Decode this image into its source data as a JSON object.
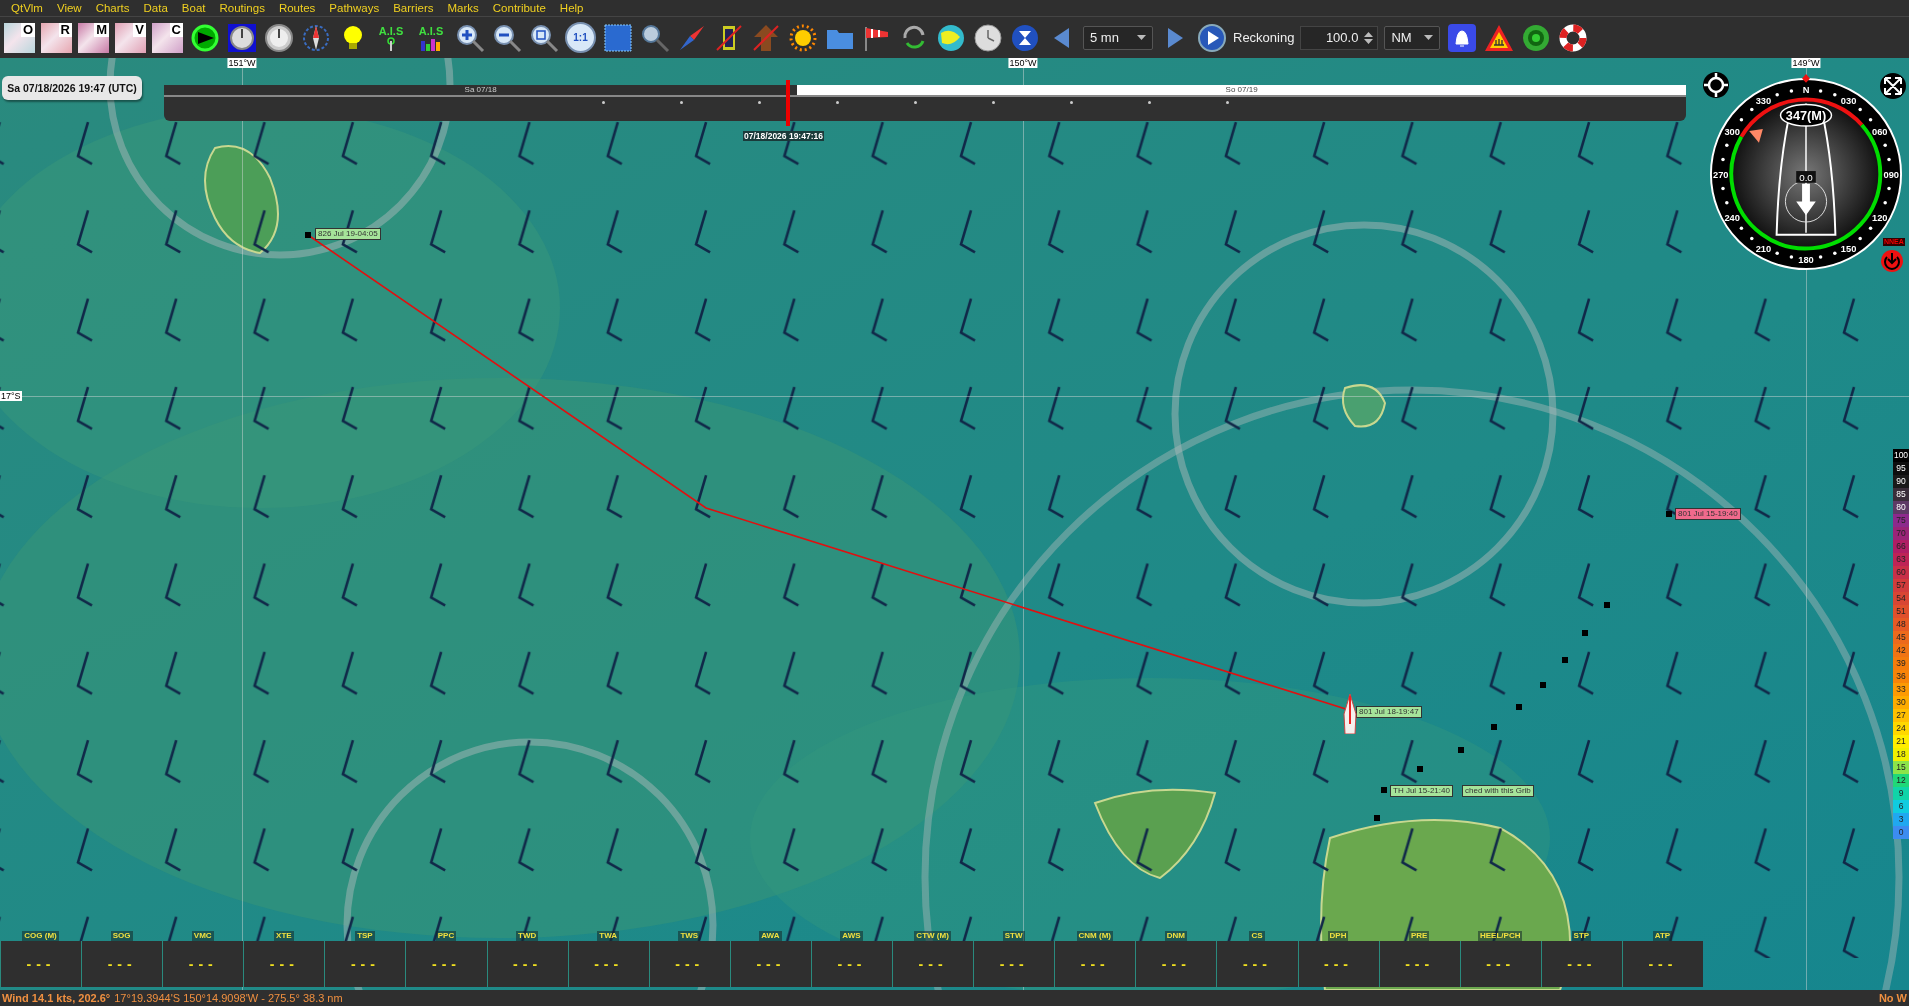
{
  "menu": [
    "QtVlm",
    "View",
    "Charts",
    "Data",
    "Boat",
    "Routings",
    "Routes",
    "Pathways",
    "Barriers",
    "Marks",
    "Contribute",
    "Help"
  ],
  "toolbar": {
    "chart_layers": [
      "O",
      "R",
      "M",
      "V",
      "C"
    ],
    "ais_labels": [
      "A.I.S",
      "A.I.S"
    ],
    "zoom_label": "1:1",
    "time_step": "5 mn",
    "mode_label": "Reckoning",
    "reckoning_value": "100.0",
    "unit": "NM"
  },
  "date_badge": "Sa 07/18/2026 19:47 (UTC)",
  "timeline": {
    "day_labels": [
      "Sa 07/18",
      "So 07/19"
    ],
    "cursor_label": "07/18/2026 19:47:16",
    "level": 0.41
  },
  "grid_labels": {
    "longitudes": [
      "151°W",
      "150°W",
      "149°W"
    ],
    "latitude": "17°S"
  },
  "marks": [
    {
      "label": "826 Jul 19-04:05",
      "color": "#a6e49a"
    },
    {
      "label": "801 Jul 18-19:47",
      "color": "#a6e49a"
    },
    {
      "label": "801 Jul 15-19:40",
      "color": "#f06a8c"
    },
    {
      "label": "TH Jul 15-21:40",
      "color": "#a6e49a"
    },
    {
      "label": "ched with this Grib",
      "color": "#a6e49a"
    }
  ],
  "compass": {
    "heading": "347(M)",
    "speed": "0.0",
    "ring_labels": [
      "N",
      "030",
      "060",
      "090",
      "120",
      "150",
      "180",
      "210",
      "240",
      "270",
      "300",
      "330"
    ],
    "nmea_label": "NNEA"
  },
  "wind_scale": [
    {
      "label": "100",
      "color": "#000000"
    },
    {
      "label": "95",
      "color": "#0e0e0e"
    },
    {
      "label": "90",
      "color": "#1a1a1a"
    },
    {
      "label": "85",
      "color": "#3a2e3a"
    },
    {
      "label": "80",
      "color": "#5e3a66"
    },
    {
      "label": "75",
      "color": "#8c2a8c"
    },
    {
      "label": "70",
      "color": "#9a2478"
    },
    {
      "label": "66",
      "color": "#b01e64"
    },
    {
      "label": "63",
      "color": "#be2456"
    },
    {
      "label": "60",
      "color": "#c83048"
    },
    {
      "label": "57",
      "color": "#d23c3c"
    },
    {
      "label": "54",
      "color": "#d84634"
    },
    {
      "label": "51",
      "color": "#e0502c"
    },
    {
      "label": "48",
      "color": "#e65a24"
    },
    {
      "label": "45",
      "color": "#ec6a1c"
    },
    {
      "label": "42",
      "color": "#f07414"
    },
    {
      "label": "39",
      "color": "#f47c0c"
    },
    {
      "label": "36",
      "color": "#f88408"
    },
    {
      "label": "33",
      "color": "#fc9a04"
    },
    {
      "label": "30",
      "color": "#feac00"
    },
    {
      "label": "27",
      "color": "#ffc000"
    },
    {
      "label": "24",
      "color": "#ffd800"
    },
    {
      "label": "21",
      "color": "#ffee00"
    },
    {
      "label": "18",
      "color": "#f0f000"
    },
    {
      "label": "15",
      "color": "#8ce44a"
    },
    {
      "label": "12",
      "color": "#20d878"
    },
    {
      "label": "9",
      "color": "#10d4a8"
    },
    {
      "label": "6",
      "color": "#10cce0"
    },
    {
      "label": "3",
      "color": "#20a8f0"
    },
    {
      "label": "0",
      "color": "#3c8cf0"
    }
  ],
  "instruments": [
    {
      "name": "COG (M)",
      "value": "---"
    },
    {
      "name": "SOG",
      "value": "---"
    },
    {
      "name": "VMC",
      "value": "---"
    },
    {
      "name": "XTE",
      "value": "---"
    },
    {
      "name": "TSP",
      "value": "---"
    },
    {
      "name": "PPC",
      "value": "---"
    },
    {
      "name": "TWD",
      "value": "---"
    },
    {
      "name": "TWA",
      "value": "---"
    },
    {
      "name": "TWS",
      "value": "---"
    },
    {
      "name": "AWA",
      "value": "---"
    },
    {
      "name": "AWS",
      "value": "---"
    },
    {
      "name": "CTW (M)",
      "value": "---"
    },
    {
      "name": "STW",
      "value": "---"
    },
    {
      "name": "CNM (M)",
      "value": "---"
    },
    {
      "name": "DNM",
      "value": "---"
    },
    {
      "name": "CS",
      "value": "---"
    },
    {
      "name": "DPH",
      "value": "---"
    },
    {
      "name": "PRE",
      "value": "---"
    },
    {
      "name": "HEEL/PCH",
      "value": "---"
    },
    {
      "name": "STP",
      "value": "---"
    },
    {
      "name": "ATP",
      "value": "---"
    }
  ],
  "status_bar": {
    "wind": "Wind 14.1 kts, 202.6°",
    "position": "17°19.3944'S 150°14.9098'W - 275.5° 38.3 nm",
    "right": "No W"
  }
}
